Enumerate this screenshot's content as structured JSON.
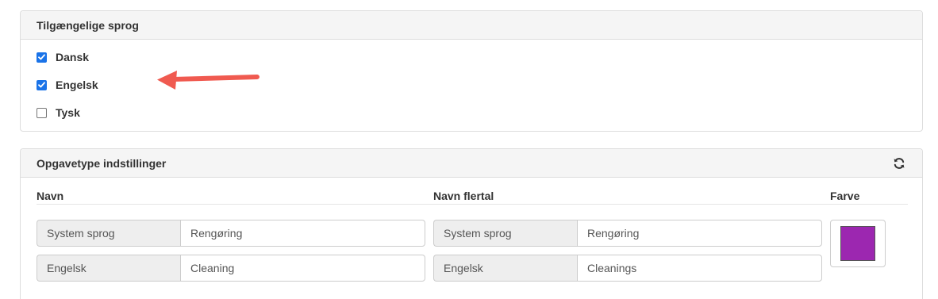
{
  "languages_panel": {
    "title": "Tilgængelige sprog",
    "options": [
      {
        "label": "Dansk",
        "checked": true
      },
      {
        "label": "Engelsk",
        "checked": true
      },
      {
        "label": "Tysk",
        "checked": false
      }
    ]
  },
  "tasktype_panel": {
    "title": "Opgavetype indstillinger",
    "refresh_icon": "refresh-icon",
    "columns": {
      "name": "Navn",
      "plural": "Navn flertal",
      "color": "Farve"
    },
    "name_rows": [
      {
        "addon": "System sprog",
        "value": "Rengøring"
      },
      {
        "addon": "Engelsk",
        "value": "Cleaning"
      }
    ],
    "plural_rows": [
      {
        "addon": "System sprog",
        "value": "Rengøring"
      },
      {
        "addon": "Engelsk",
        "value": "Cleanings"
      }
    ],
    "color_value": "#9c27b0"
  },
  "colors": {
    "checkbox_accent": "#1a73e8",
    "annotation_arrow": "#f05a50"
  }
}
